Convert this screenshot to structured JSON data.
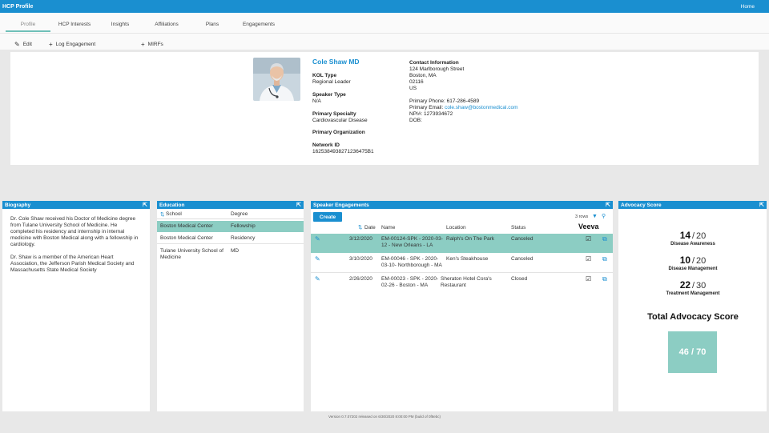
{
  "app": {
    "title": "HCP Profile",
    "home_label": "Home"
  },
  "tabs": [
    {
      "label": "Profile"
    },
    {
      "label": "HCP Interests"
    },
    {
      "label": "Insights"
    },
    {
      "label": "Affiliations"
    },
    {
      "label": "Plans"
    },
    {
      "label": "Engagements"
    }
  ],
  "toolbar": {
    "edit": "Edit",
    "log_engagement": "Log Engagement",
    "mirfs": "MIRFs"
  },
  "profile": {
    "name": "Cole Shaw MD",
    "kol_type_label": "KOL Type",
    "kol_type": "Regional Leader",
    "speaker_type_label": "Speaker Type",
    "speaker_type": "N/A",
    "primary_specialty_label": "Primary Specialty",
    "primary_specialty": "Cardiovascular Disease",
    "primary_org_label": "Primary Organization",
    "network_id_label": "Network ID",
    "network_id": "1625384938271236475B1",
    "contact_label": "Contact Information",
    "address1": "124 Marlborough Street",
    "address2": "Boston, MA",
    "zip": "02116",
    "country": "US",
    "phone": "Primary Phone: 617-286-4589",
    "email_label": "Primary Email: ",
    "email": "cole.shaw@bostonmedical.com",
    "npi": "NPI#: 1273934672",
    "dob": "DOB:"
  },
  "biography": {
    "title": "Biography",
    "p1": "Dr. Cole Shaw received his Doctor of Medicine degree from Tulane University School of Medicine. He completed his residency and internship in internal medicine with Boston Medical along with a fellowship in cardiology.",
    "p2": "Dr. Shaw is a member of the American Heart Association, the Jefferson Parish Medical Society and Massachusetts State Medical Society"
  },
  "education": {
    "title": "Education",
    "col_school": "School",
    "col_degree": "Degree",
    "rows": [
      {
        "school": "Boston Medical Center",
        "degree": "Fellowship"
      },
      {
        "school": "Boston Medical Center",
        "degree": "Residency"
      },
      {
        "school": "Tulane University School of Medicine",
        "degree": "MD"
      }
    ]
  },
  "speaker": {
    "title": "Speaker Engagements",
    "create": "Create",
    "row_count": "3 rows",
    "brand": "Veeva",
    "col_date": "Date",
    "col_name": "Name",
    "col_location": "Location",
    "col_status": "Status",
    "rows": [
      {
        "date": "3/12/2020",
        "name": "EM-00124-SPK - 2020-03-12 - New Orleans - LA",
        "location": "Ralph's On The Park",
        "status": "Canceled"
      },
      {
        "date": "3/10/2020",
        "name": "EM-00046 - SPK - 2020-03-10- Northborough - MA",
        "location": "Ken's Steakhouse",
        "status": "Canceled"
      },
      {
        "date": "2/26/2020",
        "name": "EM-00023 - SPK - 2020-02-26 - Boston - MA",
        "location": "Sheraton Hotel Cora's Restaurant",
        "status": "Closed"
      }
    ]
  },
  "advocacy": {
    "title": "Advocacy Score",
    "scores": [
      {
        "value": "14",
        "max": "20",
        "label": "Disease Awareness"
      },
      {
        "value": "10",
        "max": "20",
        "label": "Disease Management"
      },
      {
        "value": "22",
        "max": "30",
        "label": "Treatment Management"
      }
    ],
    "total_title": "Total Advocacy Score",
    "total": "46 / 70"
  },
  "footer": "Version 0.7.07202 released on 6/30/2020 8:00:00 PM (build of 0f8ebc)",
  "colors": {
    "accent": "#1a8fd0",
    "selected_row": "#8ccdc3"
  }
}
